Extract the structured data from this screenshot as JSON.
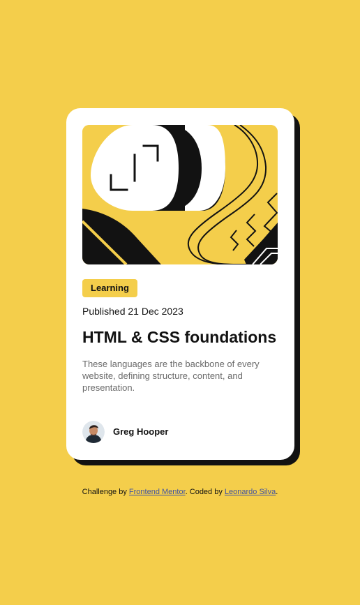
{
  "card": {
    "image_alt": "Illustration",
    "category": "Learning",
    "published": "Published 21 Dec 2023",
    "title": "HTML & CSS foundations",
    "description": "These languages are the backbone of every website, defining structure, content, and presentation.",
    "author": {
      "name": "Greg Hooper"
    }
  },
  "attribution": {
    "challenge_prefix": "Challenge by ",
    "challenge_link": "Frontend Mentor",
    "coded_prefix": ". Coded by ",
    "coded_link": "Leonardo Silva",
    "suffix": "."
  },
  "colors": {
    "background": "#F4CE4B",
    "card": "#FFFFFF",
    "text": "#121212",
    "muted": "#6B6B6B",
    "link": "#3E52A3"
  }
}
